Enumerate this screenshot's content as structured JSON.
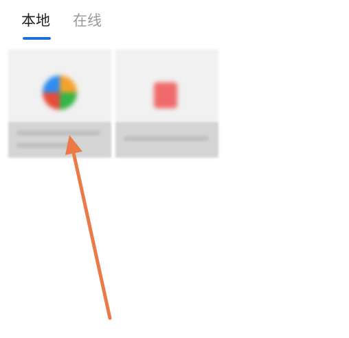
{
  "tabs": {
    "local_label": "本地",
    "online_label": "在线",
    "active": "本地"
  },
  "colors": {
    "accent": "#1e73d8",
    "arrow": "#ec7a47",
    "tab_active_text": "#202124",
    "tab_inactive_text": "#9a9a9a"
  },
  "icons": {
    "tile_1": "colorful-app-icon",
    "tile_2": "red-document-icon"
  }
}
